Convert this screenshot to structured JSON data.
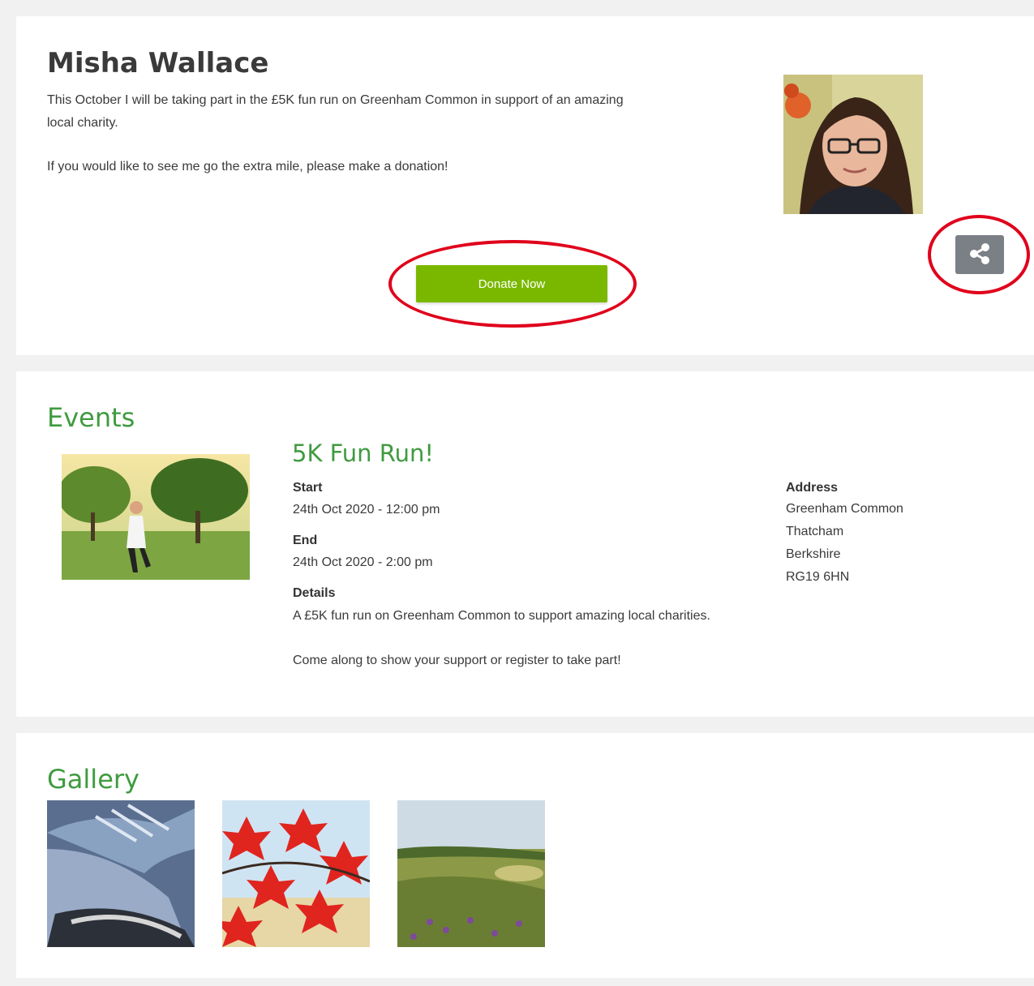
{
  "profile": {
    "name": "Misha Wallace",
    "bio_line1": "This October I will be taking part in the £5K fun run on Greenham Common in support of an amazing local charity.",
    "bio_line2": "If you would like to see me go the extra mile, please make a donation!",
    "donate_label": "Donate Now",
    "share_icon": "share-icon",
    "accent_color": "#7ab800",
    "highlight_color": "#e0001b"
  },
  "events": {
    "heading": "Events",
    "title": "5K Fun Run!",
    "start_label": "Start",
    "start_value": "24th Oct 2020 - 12:00 pm",
    "end_label": "End",
    "end_value": "24th Oct 2020 - 2:00 pm",
    "details_label": "Details",
    "details_line1": "A £5K fun run on Greenham Common to support amazing local charities.",
    "details_line2": "Come along to show your support or register to take part!",
    "address_label": "Address",
    "address_lines": [
      "Greenham Common",
      "Thatcham",
      "Berkshire",
      "RG19 6HN"
    ],
    "heading_color": "#3f9b3f"
  },
  "gallery": {
    "heading": "Gallery",
    "images": [
      "running-shoe-image",
      "red-maple-leaves-image",
      "heathland-image"
    ]
  }
}
